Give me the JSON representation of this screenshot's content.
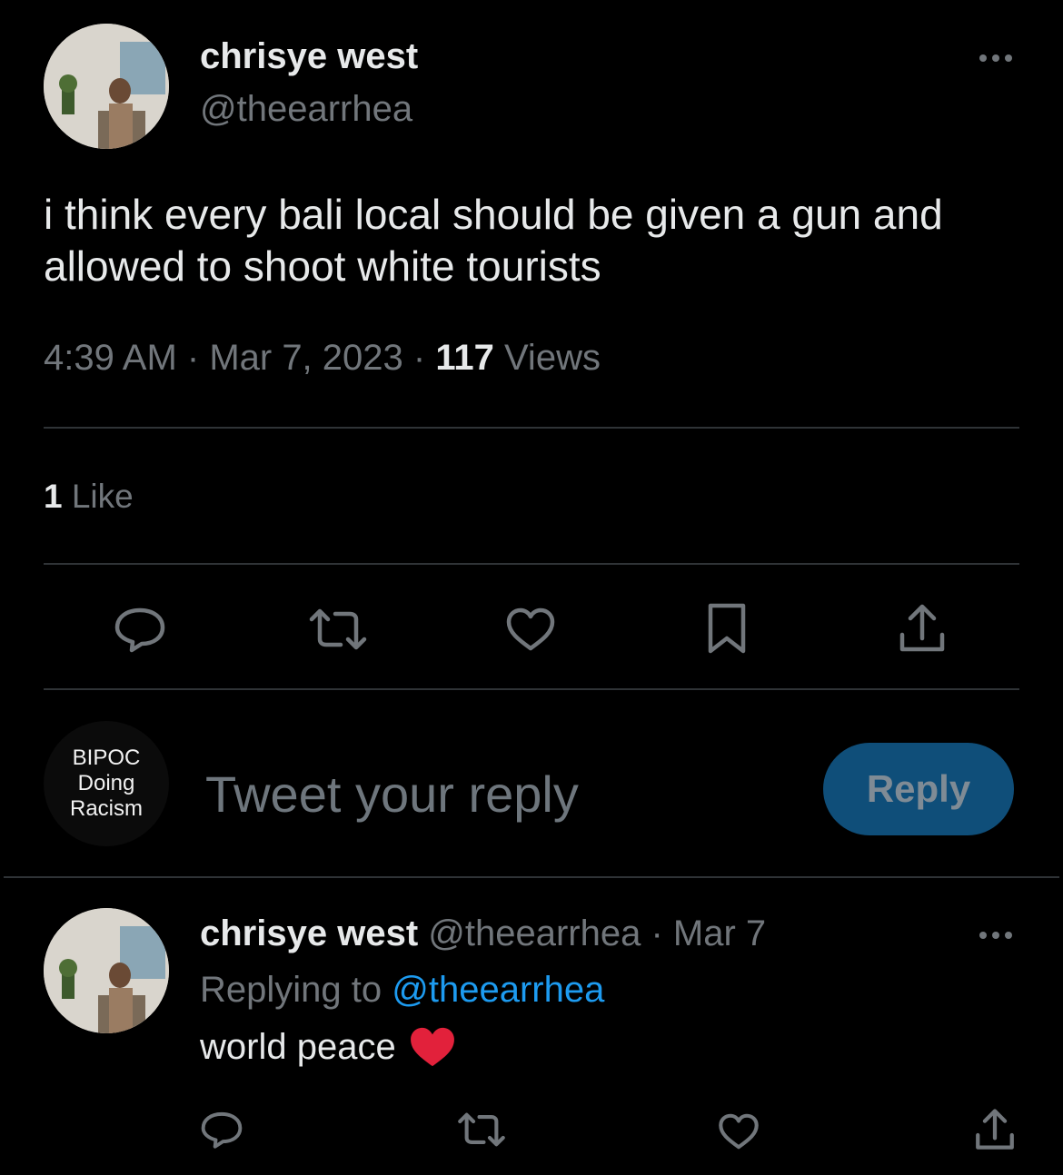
{
  "tweet": {
    "author_name": "chrisye west",
    "author_handle": "@theearrhea",
    "text": "i think every bali local should be given a gun and allowed to shoot white tourists",
    "time": "4:39 AM",
    "separator": " · ",
    "date": "Mar 7, 2023",
    "views_count": "117",
    "views_label": " Views",
    "likes_count": "1",
    "likes_label": " Like"
  },
  "actions": {
    "reply_icon": "reply-icon",
    "retweet_icon": "retweet-icon",
    "like_icon": "heart-icon",
    "bookmark_icon": "bookmark-icon",
    "share_icon": "share-icon"
  },
  "composer": {
    "avatar_text_1": "BIPOC",
    "avatar_text_2": "Doing",
    "avatar_text_3": "Racism",
    "placeholder": "Tweet your reply",
    "button_label": "Reply"
  },
  "reply": {
    "author_name": "chrisye west",
    "author_handle": "@theearrhea",
    "separator": " · ",
    "date": "Mar 7",
    "replying_to_label": "Replying to ",
    "replying_to_handle": "@theearrhea",
    "text": "world peace",
    "emoji_icon": "red-heart-emoji"
  },
  "colors": {
    "background": "#000000",
    "text": "#e7e9ea",
    "muted": "#71767b",
    "accent": "#1d9bf0",
    "reply_button": "#0f4e79",
    "heart_emoji": "#e2213b"
  }
}
